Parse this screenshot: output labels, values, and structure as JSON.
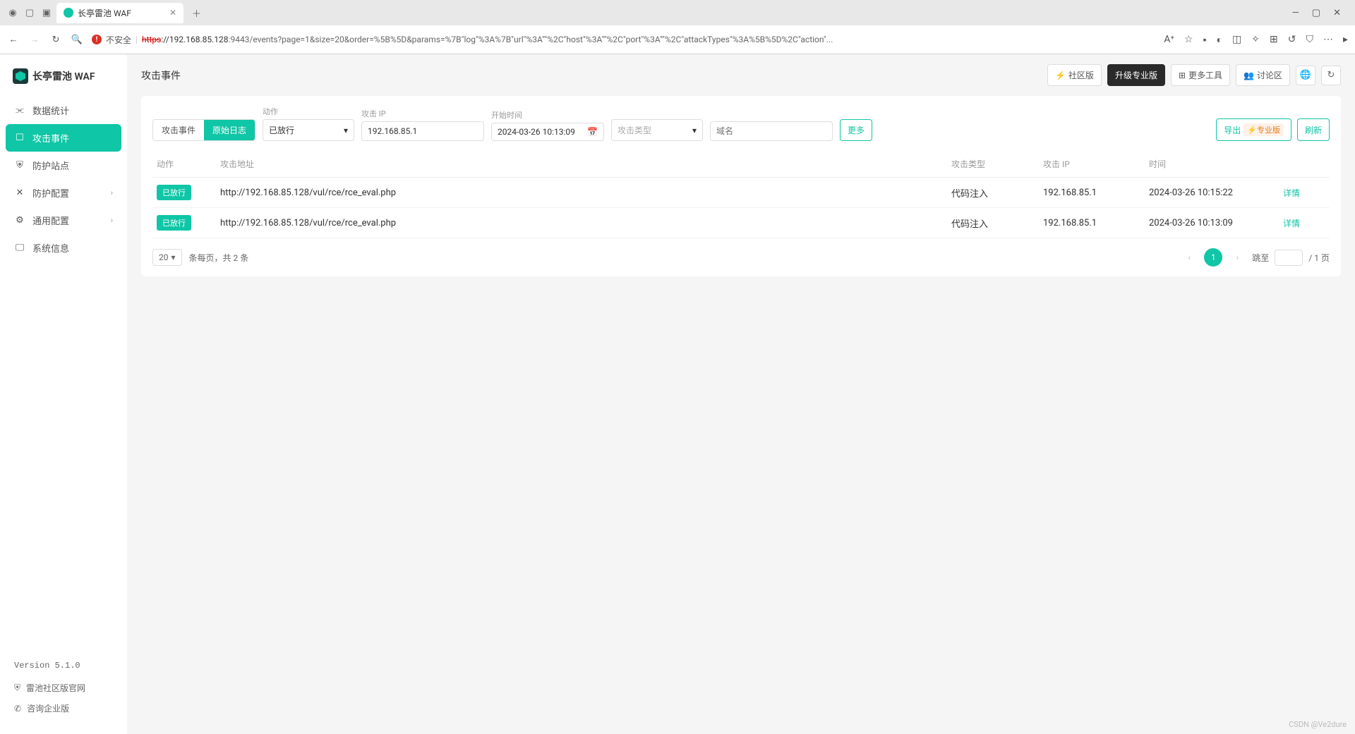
{
  "browser": {
    "tab_title": "长亭雷池 WAF",
    "insecure_label": "不安全",
    "url_https": "https",
    "url_host": "://192.168.85.128",
    "url_rest": ":9443/events?page=1&size=20&order=%5B%5D&params=%7B\"log\"%3A%7B\"url\"%3A\"\"%2C\"host\"%3A\"\"%2C\"port\"%3A\"\"%2C\"attackTypes\"%3A%5B%5D%2C\"action\"..."
  },
  "app": {
    "brand": "长亭雷池 WAF",
    "version": "Version 5.1.0",
    "footer_link1": "雷池社区版官网",
    "footer_link2": "咨询企业版"
  },
  "sidebar": {
    "items": [
      {
        "label": "数据统计"
      },
      {
        "label": "攻击事件"
      },
      {
        "label": "防护站点"
      },
      {
        "label": "防护配置"
      },
      {
        "label": "通用配置"
      },
      {
        "label": "系统信息"
      }
    ]
  },
  "topbar": {
    "breadcrumb": "攻击事件",
    "community": "社区版",
    "upgrade": "升级专业版",
    "more_tools": "更多工具",
    "forum": "讨论区"
  },
  "filters": {
    "toggle_events": "攻击事件",
    "toggle_raw": "原始日志",
    "action_label": "动作",
    "action_value": "已放行",
    "ip_label": "攻击 IP",
    "ip_value": "192.168.85.1",
    "start_label": "开始时间",
    "start_value": "2024-03-26 10:13:09",
    "type_placeholder": "攻击类型",
    "domain_placeholder": "域名",
    "more": "更多",
    "export": "导出",
    "pro_badge": "专业版",
    "refresh": "刷新"
  },
  "table": {
    "headers": {
      "action": "动作",
      "url": "攻击地址",
      "type": "攻击类型",
      "ip": "攻击 IP",
      "time": "时间"
    },
    "rows": [
      {
        "action": "已放行",
        "url": "http://192.168.85.128/vul/rce/rce_eval.php",
        "type": "代码注入",
        "ip": "192.168.85.1",
        "time": "2024-03-26 10:15:22",
        "detail": "详情"
      },
      {
        "action": "已放行",
        "url": "http://192.168.85.128/vul/rce/rce_eval.php",
        "type": "代码注入",
        "ip": "192.168.85.1",
        "time": "2024-03-26 10:13:09",
        "detail": "详情"
      }
    ]
  },
  "pagination": {
    "page_size": "20",
    "summary": "条每页，共 2 条",
    "current": "1",
    "jump_label": "跳至",
    "total_suffix": "/ 1 页"
  },
  "watermark": "CSDN @Ve2dure"
}
